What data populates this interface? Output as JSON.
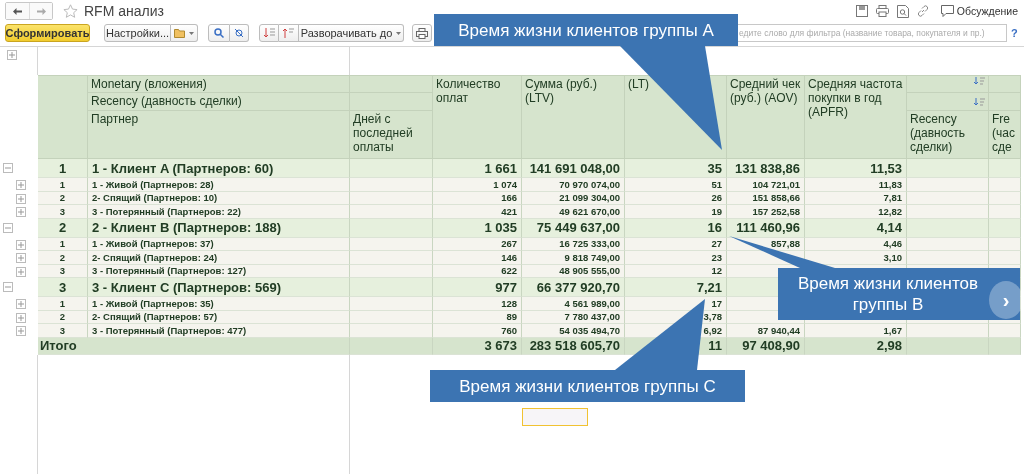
{
  "window": {
    "title": "RFM анализ",
    "discussion": "Обсуждение"
  },
  "toolbar": {
    "generate": "Сформировать",
    "settings": "Настройки...",
    "expand_to": "Разворачивать до",
    "filter_placeholder": "едите слово для фильтра (название товара, покупателя и пр.)",
    "help": "?"
  },
  "table": {
    "header_rows": [
      "Monetary (вложения)",
      "Recency (давность сделки)"
    ],
    "columns": [
      "Партнер",
      "Дней с последней оплаты",
      "Количество оплат",
      "Сумма (руб.) (LTV)",
      "(LT)",
      "Средний чек (руб.) (AOV)",
      "Средняя частота покупки в год (APFR)",
      "Recency (давность сделки)",
      "Fre (час сде"
    ],
    "rows": [
      {
        "kind": "group",
        "expanded": true,
        "number": "1",
        "name": "1 - Клиент A (Партнеров: 60)",
        "payments": "1 661",
        "sum": "141 691 048,00",
        "lt": "35",
        "aov": "131 838,86",
        "apfr": "11,53"
      },
      {
        "kind": "item",
        "expanded": false,
        "number": "1",
        "name": "1 - Живой (Партнеров: 28)",
        "payments": "1 074",
        "sum": "70 970 074,00",
        "lt": "51",
        "aov": "104 721,01",
        "apfr": "11,83"
      },
      {
        "kind": "item",
        "expanded": false,
        "number": "2",
        "name": "2- Спящий (Партнеров: 10)",
        "payments": "166",
        "sum": "21 099 304,00",
        "lt": "26",
        "aov": "151 858,66",
        "apfr": "7,81"
      },
      {
        "kind": "item",
        "expanded": false,
        "number": "3",
        "name": "3 - Потерянный (Партнеров: 22)",
        "payments": "421",
        "sum": "49 621 670,00",
        "lt": "19",
        "aov": "157 252,58",
        "apfr": "12,82"
      },
      {
        "kind": "group",
        "expanded": true,
        "number": "2",
        "name": "2 - Клиент B (Партнеров: 188)",
        "payments": "1 035",
        "sum": "75 449 637,00",
        "lt": "16",
        "aov": "111 460,96",
        "apfr": "4,14"
      },
      {
        "kind": "item",
        "expanded": false,
        "number": "1",
        "name": "1 - Живой (Партнеров: 37)",
        "payments": "267",
        "sum": "16 725 333,00",
        "lt": "27",
        "aov": "857,88",
        "apfr": "4,46"
      },
      {
        "kind": "item",
        "expanded": false,
        "number": "2",
        "name": "2- Спящий (Партнеров: 24)",
        "payments": "146",
        "sum": "9 818 749,00",
        "lt": "23",
        "apfr": "3,10"
      },
      {
        "kind": "item",
        "expanded": false,
        "number": "3",
        "name": "3 - Потерянный (Партнеров: 127)",
        "payments": "622",
        "sum": "48 905 555,00",
        "lt": "12"
      },
      {
        "kind": "group",
        "expanded": true,
        "number": "3",
        "name": "3 - Клиент C (Партнеров: 569)",
        "payments": "977",
        "sum": "66 377 920,70",
        "lt": "7,21"
      },
      {
        "kind": "item",
        "expanded": false,
        "number": "1",
        "name": "1 - Живой (Партнеров: 35)",
        "payments": "128",
        "sum": "4 561 989,00",
        "lt": "17"
      },
      {
        "kind": "item",
        "expanded": false,
        "number": "2",
        "name": "2- Спящий (Партнеров: 57)",
        "payments": "89",
        "sum": "7 780 437,00",
        "lt": "3,78"
      },
      {
        "kind": "item",
        "expanded": false,
        "number": "3",
        "name": "3 - Потерянный (Партнеров: 477)",
        "payments": "760",
        "sum": "54 035 494,70",
        "lt": "6,92",
        "aov": "87 940,44",
        "apfr": "1,67"
      },
      {
        "kind": "total",
        "number": "Итого",
        "payments": "3 673",
        "sum": "283 518 605,70",
        "lt": "11",
        "aov": "97 408,90",
        "apfr": "2,98"
      }
    ]
  },
  "callouts": [
    {
      "text": "Время жизни клиентов группы A"
    },
    {
      "text": "Время жизни клиентов группы B"
    },
    {
      "text": "Время жизни клиентов группы C"
    }
  ],
  "next_button": "›"
}
